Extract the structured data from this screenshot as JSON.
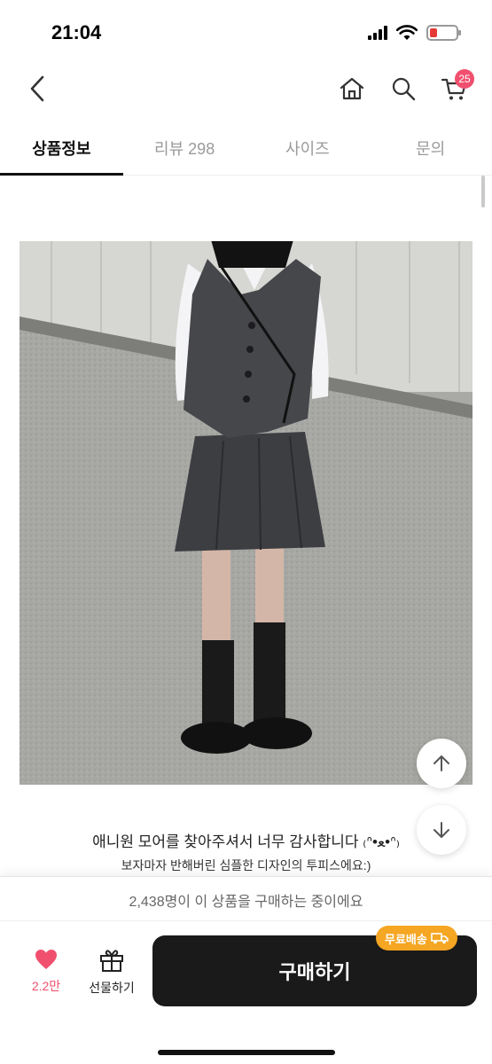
{
  "status_bar": {
    "time": "21:04"
  },
  "header": {
    "cart_count": "25"
  },
  "tabs": [
    {
      "label": "상품정보",
      "active": true
    },
    {
      "label": "리뷰 298",
      "active": false
    },
    {
      "label": "사이즈",
      "active": false
    },
    {
      "label": "문의",
      "active": false
    }
  ],
  "description": {
    "line1": "애니원 모어를 찾아주셔서 너무 감사합니다 ₍ᐢ•ﻌ•ᐢ₎",
    "line2": "보자마자 반해버린 심플한 디자인의 투피스에요:)"
  },
  "bottom_bar": {
    "buyers_text": "2,438명이 이 상품을 구매하는 중이에요",
    "like_count": "2.2만",
    "gift_label": "선물하기",
    "buy_label": "구매하기",
    "shipping_badge": "무료배송"
  },
  "colors": {
    "accent": "#f0506e",
    "buy_button": "#1a1a1a",
    "shipping_badge": "#f5a623"
  }
}
